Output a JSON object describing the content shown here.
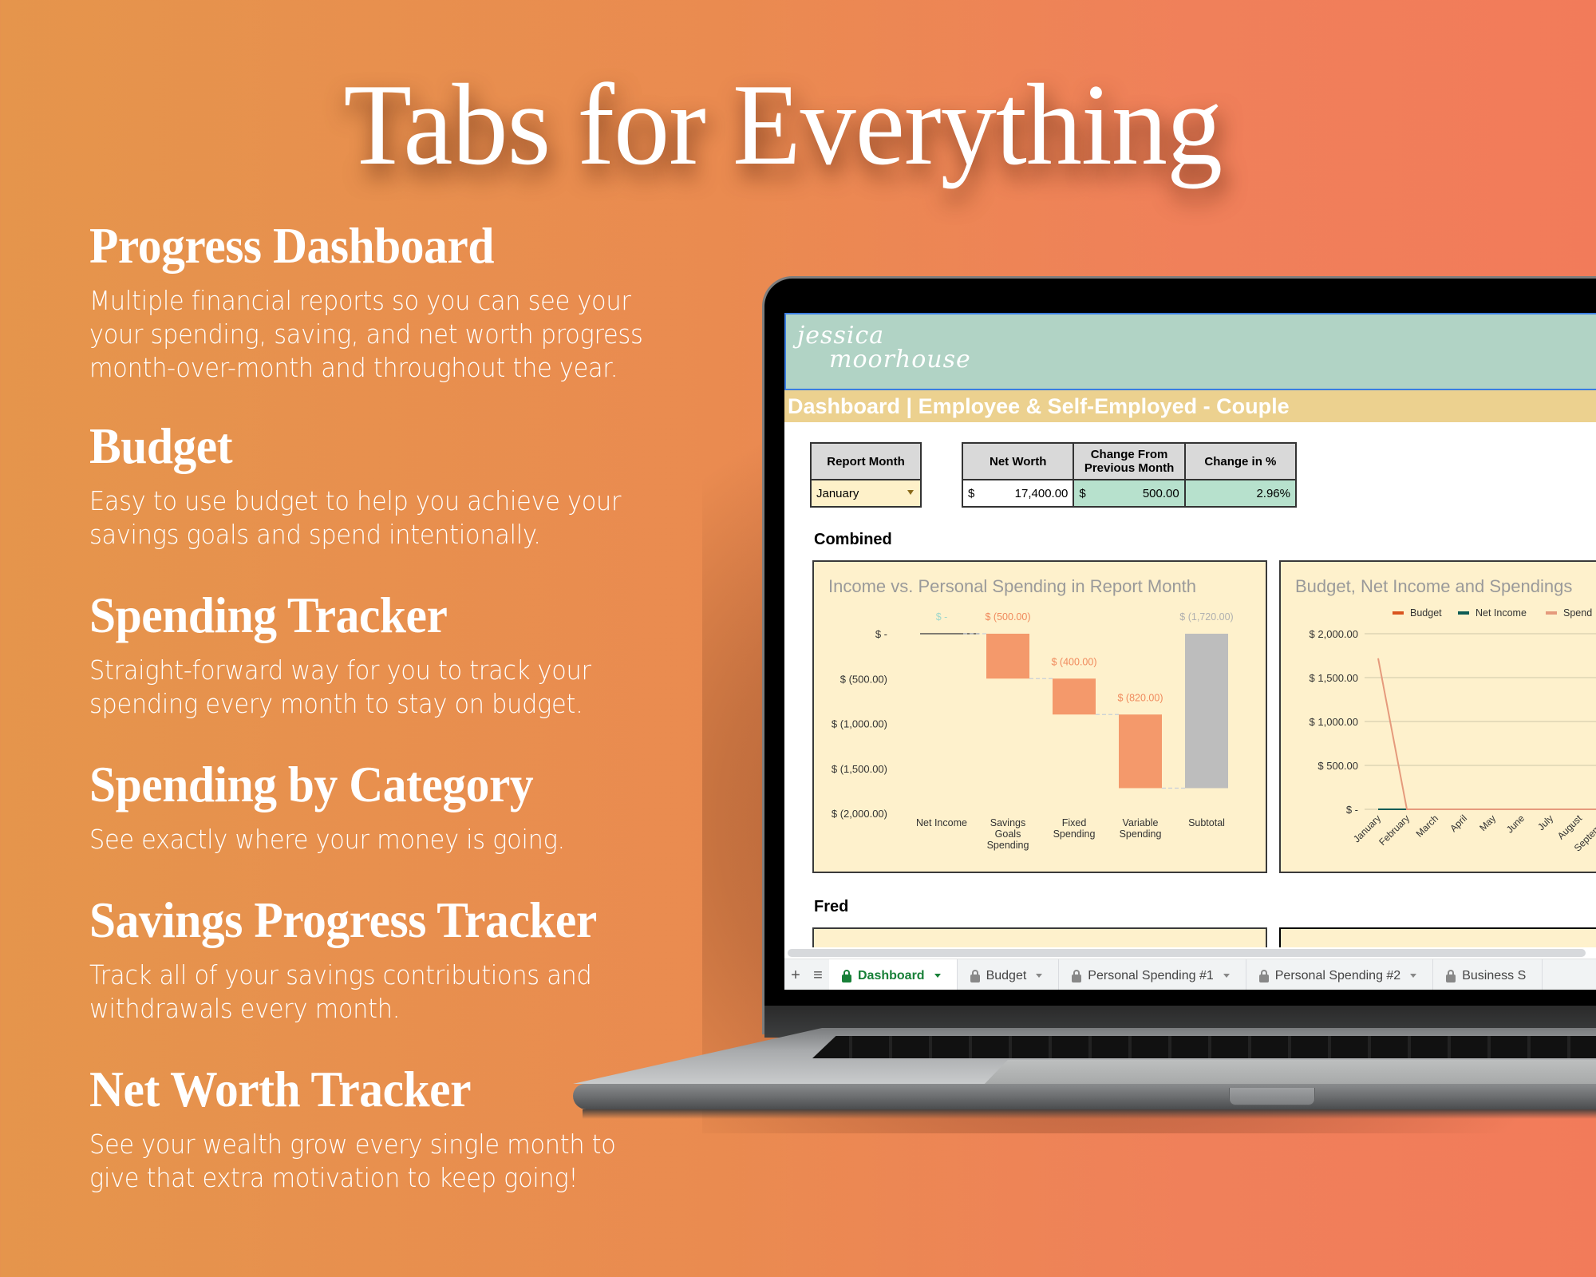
{
  "headline": "Tabs for Everything",
  "features": [
    {
      "title": "Progress Dashboard",
      "lines": [
        "Multiple financial reports so you can see your",
        "your spending, saving, and net worth progress",
        "month-over-month and throughout the year."
      ]
    },
    {
      "title": "Budget",
      "lines": [
        "Easy to use budget to help you achieve your",
        "savings goals and spend intentionally."
      ]
    },
    {
      "title": "Spending Tracker",
      "lines": [
        "Straight-forward way for you to track your",
        "spending every month to stay on budget."
      ]
    },
    {
      "title": "Spending by Category",
      "lines": [
        "See exactly where your money is going."
      ]
    },
    {
      "title": "Savings Progress Tracker",
      "lines": [
        "Track all of your savings contributions and",
        "withdrawals every month."
      ]
    },
    {
      "title": "Net Worth Tracker",
      "lines": [
        "See your wealth grow every single month to",
        "give that extra motivation to keep going!"
      ]
    }
  ],
  "spreadsheet": {
    "logo_line1": "jessica",
    "logo_line2": "moorhouse",
    "title": "Dashboard | Employee & Self-Employed - Couple",
    "report_month": {
      "header": "Report Month",
      "value": "January"
    },
    "summary": {
      "headers": [
        "Net Worth",
        "Change From Previous Month",
        "Change in %"
      ],
      "net_worth_currency": "$",
      "net_worth": "17,400.00",
      "change_currency": "$",
      "change": "500.00",
      "change_pct": "2.96%"
    },
    "sections": {
      "combined": "Combined",
      "fred": "Fred"
    },
    "tabs": [
      {
        "label": "Dashboard",
        "active": true
      },
      {
        "label": "Budget",
        "active": false
      },
      {
        "label": "Personal Spending #1",
        "active": false
      },
      {
        "label": "Personal Spending #2",
        "active": false
      },
      {
        "label": "Business S",
        "active": false
      }
    ],
    "colors": {
      "accent_green": "#188038",
      "header_teal": "#b1d3c5",
      "title_gold": "#ecd18f",
      "chart_bg": "#fef1cc"
    }
  },
  "chart_data": [
    {
      "type": "bar",
      "subtype": "waterfall",
      "title": "Income vs. Personal Spending in Report Month",
      "categories": [
        "Net Income",
        "Savings Goals Spending",
        "Fixed Spending",
        "Variable Spending",
        "Subtotal"
      ],
      "category_lines": [
        [
          "Net Income"
        ],
        [
          "Savings",
          "Goals",
          "Spending"
        ],
        [
          "Fixed",
          "Spending"
        ],
        [
          "Variable",
          "Spending"
        ],
        [
          "Subtotal"
        ]
      ],
      "values": [
        0,
        -500,
        -400,
        -820,
        -1720
      ],
      "data_labels": [
        "$ -",
        "$ (500.00)",
        "$ (400.00)",
        "$ (820.00)",
        "$ (1,720.00)"
      ],
      "ylim": [
        -2000,
        0
      ],
      "yticks": [
        0,
        -500,
        -1000,
        -1500,
        -2000
      ],
      "ytick_labels": [
        "$ -",
        "$ (500.00)",
        "$ (1,000.00)",
        "$ (1,500.00)",
        "$ (2,000.00)"
      ],
      "colors": {
        "increase": "#9fd8cc",
        "decrease": "#f4996b",
        "subtotal": "#bdbdbd",
        "label_decrease": "#f08a5d",
        "label_subtotal": "#b0b0b0"
      }
    },
    {
      "type": "line",
      "title": "Budget, Net Income and Spendings",
      "x": [
        "January",
        "February",
        "March",
        "April",
        "May",
        "June",
        "July",
        "August",
        "September"
      ],
      "series": [
        {
          "name": "Budget",
          "color": "#d9541e",
          "values": [
            0,
            0,
            0,
            0,
            0,
            0,
            0,
            0,
            0
          ]
        },
        {
          "name": "Net Income",
          "color": "#0d5c55",
          "values": [
            0,
            0,
            0,
            0,
            0,
            0,
            0,
            0,
            0
          ]
        },
        {
          "name": "Spending",
          "color": "#e59a7c",
          "values": [
            1720,
            0,
            0,
            0,
            0,
            0,
            0,
            0,
            0
          ]
        }
      ],
      "legend_labels": [
        "Budget",
        "Net Income",
        "Spend"
      ],
      "ylim": [
        0,
        2000
      ],
      "yticks": [
        0,
        500,
        1000,
        1500,
        2000
      ],
      "ytick_labels": [
        "$ -",
        "$ 500.00",
        "$ 1,000.00",
        "$ 1,500.00",
        "$ 2,000.00"
      ],
      "grid": true,
      "legend": "top"
    }
  ]
}
